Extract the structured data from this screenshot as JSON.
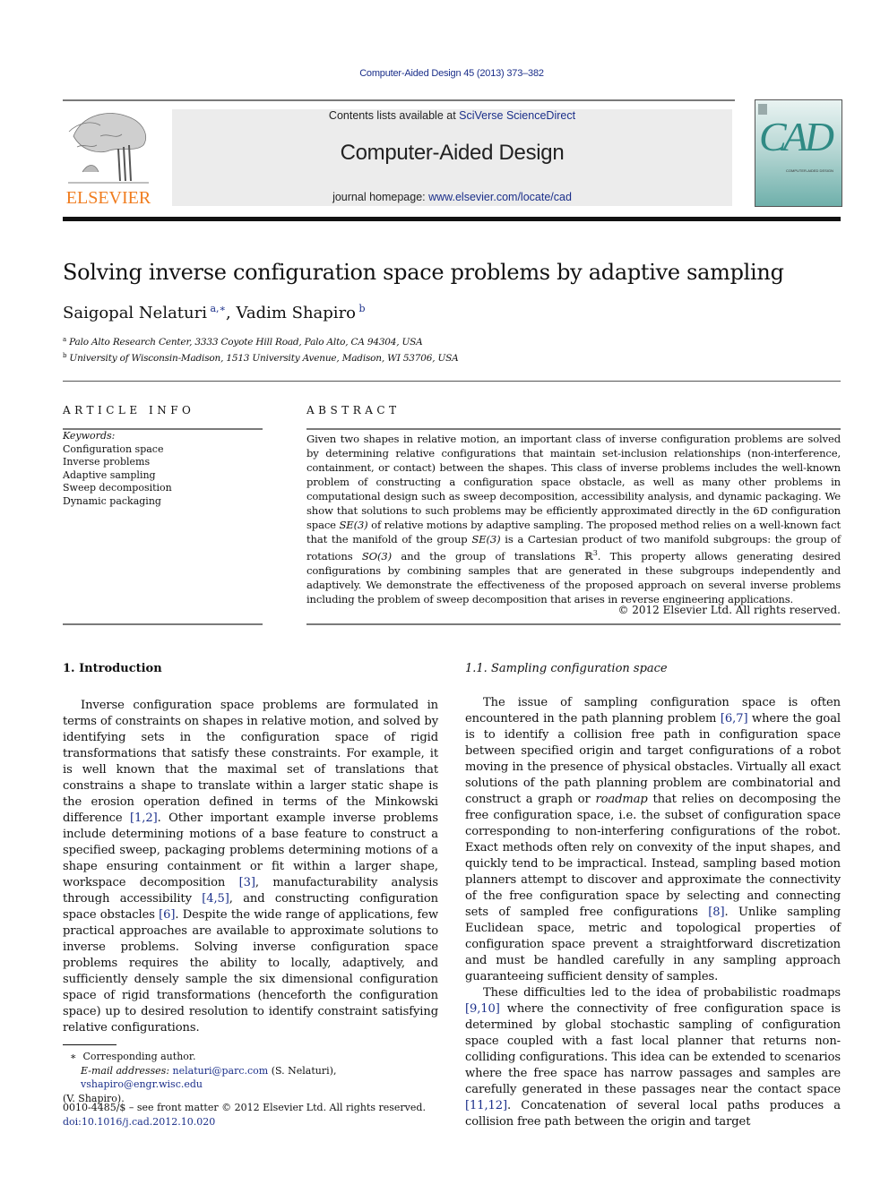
{
  "header": {
    "citation": "Computer-Aided Design 45 (2013) 373–382",
    "contents_prefix": "Contents lists available at ",
    "contents_link": "SciVerse ScienceDirect",
    "journal_name": "Computer-Aided Design",
    "homepage_prefix": "journal homepage: ",
    "homepage_link": "www.elsevier.com/locate/cad",
    "publisher_logo_text": "ELSEVIER",
    "cover_text": "CAD",
    "cover_subtitle": "COMPUTER-AIDED DESIGN",
    "colors": {
      "link": "#1b2f8a",
      "elsevier_orange": "#f07c1e",
      "cover_teal": "#2f8a84"
    }
  },
  "article": {
    "title": "Solving inverse configuration space problems by adaptive sampling",
    "authors": [
      {
        "name": "Saigopal Nelaturi",
        "sup": "a,∗"
      },
      {
        "name": "Vadim Shapiro",
        "sup": "b"
      }
    ],
    "affiliations": [
      {
        "mark": "a",
        "text": "Palo Alto Research Center, 3333 Coyote Hill Road, Palo Alto, CA 94304, USA"
      },
      {
        "mark": "b",
        "text": "University of Wisconsin-Madison, 1513 University Avenue, Madison, WI 53706, USA"
      }
    ]
  },
  "article_info": {
    "heading": "ARTICLE INFO",
    "keywords_label": "Keywords:",
    "keywords": [
      "Configuration space",
      "Inverse problems",
      "Adaptive sampling",
      "Sweep decomposition",
      "Dynamic packaging"
    ]
  },
  "abstract": {
    "heading": "ABSTRACT",
    "p1": "Given two shapes in relative motion, an important class of inverse configuration problems are solved by determining relative configurations that maintain set-inclusion relationships (non-interference, containment, or contact) between the shapes. This class of inverse problems includes the well-known problem of constructing a configuration space obstacle, as well as many other problems in computational design such as sweep decomposition, accessibility analysis, and dynamic packaging. We show that solutions to such problems may be efficiently approximated directly in the 6D configuration space ",
    "se3": "SE(3)",
    "p2": " of relative motions by adaptive sampling. The proposed method relies on a well-known fact that the manifold of the group ",
    "p3": " is a Cartesian product of two manifold subgroups: the group of rotations ",
    "so3": "SO(3)",
    "p4": " and the group of translations ℝ",
    "sup3": "3",
    "p5": ". This property allows generating desired configurations by combining samples that are generated in these subgroups independently and adaptively. We demonstrate the effectiveness of the proposed approach on several inverse problems including the problem of sweep decomposition that arises in reverse engineering applications.",
    "copyright": "© 2012 Elsevier Ltd. All rights reserved."
  },
  "section1": {
    "heading": "1.  Introduction",
    "t1": "Inverse configuration space problems are formulated in terms of constraints on shapes in relative motion, and solved by identifying sets in the configuration space of rigid transformations that satisfy these constraints. For example, it is well known that the maximal set of translations that constrains a shape to translate within a larger static shape is the erosion operation defined in terms of the Minkowski difference ",
    "r1": "[1,2]",
    "t2": ". Other important example inverse problems include determining motions of a base feature to construct a specified sweep, packaging problems determining motions of a shape ensuring containment or fit within a larger shape, workspace decomposition ",
    "r2": "[3]",
    "t3": ", manufacturability analysis through accessibility ",
    "r3": "[4,5]",
    "t4": ", and constructing configuration space obstacles ",
    "r4": "[6]",
    "t5": ". Despite the wide range of applications, few practical approaches are available to approximate solutions to inverse problems. Solving inverse configuration space problems requires the ability to locally, adaptively, and sufficiently densely sample the six dimensional configuration space of rigid transformations (henceforth the configuration space) up to desired resolution to identify constraint satisfying relative configurations."
  },
  "section11": {
    "heading": "1.1.  Sampling configuration space",
    "a1": "The issue of sampling configuration space is often encountered in the path planning problem ",
    "ar1": "[6,7]",
    "a2": " where the goal is to identify a collision free path in configuration space between specified origin and target configurations of a robot moving in the presence of physical obstacles. Virtually all exact solutions of the path planning problem are combinatorial and construct a graph or ",
    "a_em": "roadmap",
    "a3": " that relies on decomposing the free configuration space, i.e. the subset of configuration space corresponding to non-interfering configurations of the robot. Exact methods often rely on convexity of the input shapes, and quickly tend to be impractical. Instead, sampling based motion planners attempt to discover and approximate the connectivity of the free configuration space by selecting and connecting sets of sampled free configurations ",
    "ar2": "[8]",
    "a4": ". Unlike sampling Euclidean space, metric and topological properties of configuration space prevent a straightforward discretization and must be handled carefully in any sampling approach guaranteeing sufficient density of samples.",
    "b1": "These difficulties led to the idea of probabilistic roadmaps ",
    "br1": "[9,10]",
    "b2": " where the connectivity of free configuration space is determined by global stochastic sampling of configuration space coupled with a fast local planner that returns non-colliding configurations. This idea can be extended to scenarios where the free space has narrow passages and samples are carefully generated in these passages near the contact space ",
    "br2": "[11,12]",
    "b3": ". Concatenation of several local paths produces a collision free path between the origin and target"
  },
  "footnotes": {
    "star": "∗",
    "corresponding": "Corresponding author.",
    "email_label": "E-mail addresses:",
    "email1": "nelaturi@parc.com",
    "email1_who": " (S. Nelaturi), ",
    "email2": "vshapiro@engr.wisc.edu",
    "email2_who": "(V. Shapiro).",
    "front_matter": "0010-4485/$ – see front matter © 2012 Elsevier Ltd. All rights reserved.",
    "doi": "doi:10.1016/j.cad.2012.10.020"
  }
}
